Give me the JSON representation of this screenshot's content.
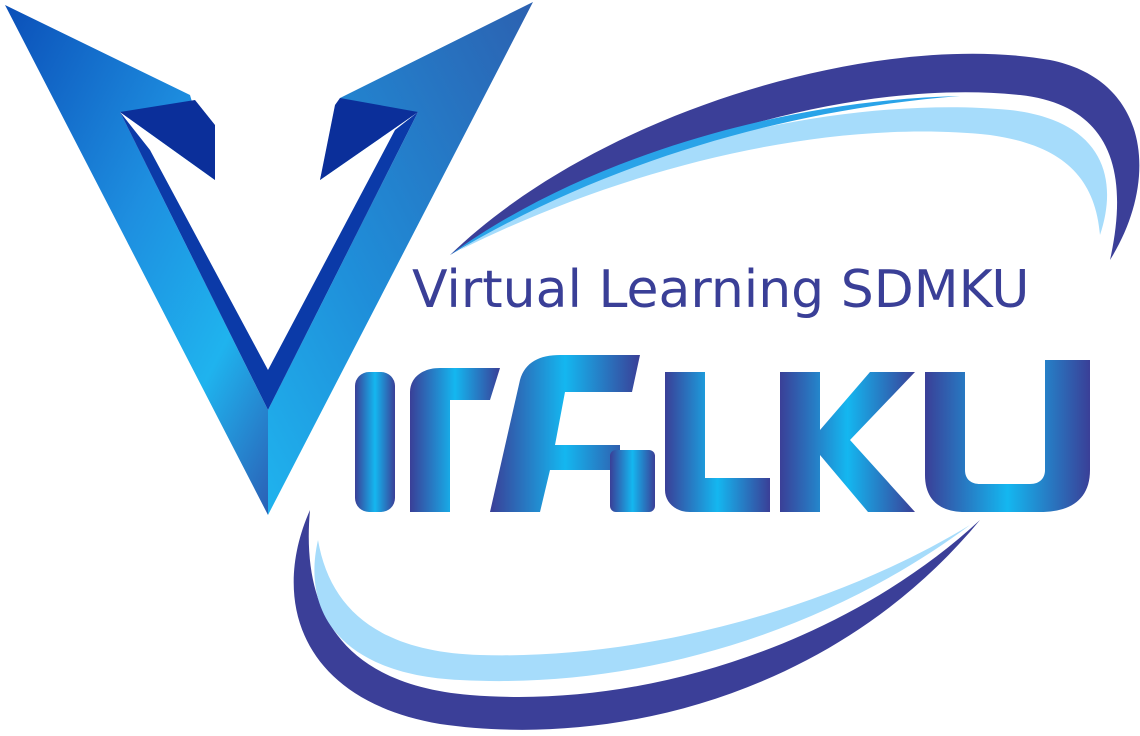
{
  "logo": {
    "tagline": "Virtual Learning SDMKU",
    "wordmark": "VIRALKU"
  },
  "colors": {
    "background": "#ffffff",
    "tagline_text": "#3a3f97",
    "v_light": "#1fb3ee",
    "v_mid": "#1f7fd0",
    "v_dark": "#0b2f9a",
    "swoosh_dark": "#3b3f98",
    "swoosh_light": "#a6dcfb",
    "swoosh_mid": "#29a3e8",
    "letters_dark": "#3a3f97",
    "letters_light": "#14b7f0"
  },
  "icons": {
    "emblem": "v-chevron-emblem",
    "orbit": "orbit-swoosh"
  }
}
